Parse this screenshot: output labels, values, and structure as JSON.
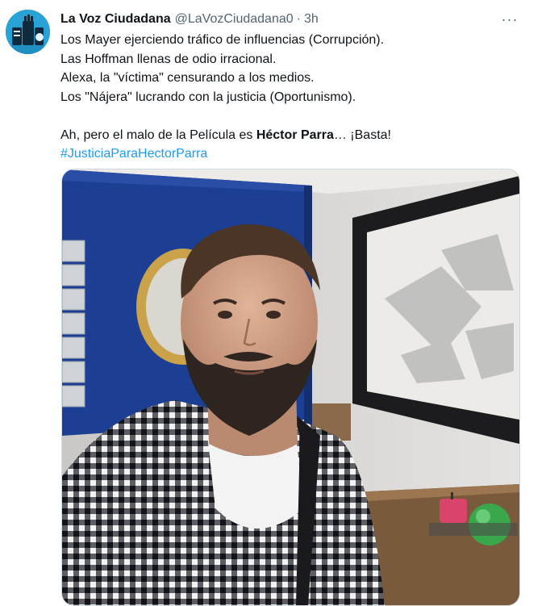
{
  "tweet": {
    "author_name": "La Voz Ciudadana",
    "author_handle": "@LaVozCiudadana0",
    "separator": "·",
    "time": "3h",
    "more_icon": "···",
    "lines": [
      "Los Mayer ejerciendo tráfico de influencias (Corrupción).",
      "Las Hoffman llenas de odio irracional.",
      "Alexa, la \"víctima\" censurando a los medios.",
      "Los \"Nájera\" lucrando con la justicia (Oportunismo)."
    ],
    "closing_prefix": "Ah, pero el malo de la Película es ",
    "closing_bold": "Héctor Parra",
    "closing_suffix": "… ¡Basta!",
    "hashtag": "#JusticiaParaHectorParra"
  },
  "colors": {
    "link": "#1d9bf0",
    "secondary_text": "#536471",
    "avatar_bg": "#29a3d6"
  },
  "icons": {
    "more": "more-horizontal-icon",
    "avatar": "raised-fists-logo"
  }
}
